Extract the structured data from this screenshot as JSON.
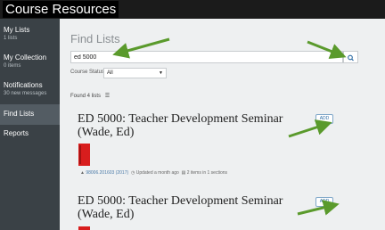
{
  "app": {
    "title": "Course Resources"
  },
  "sidebar": {
    "items": [
      {
        "label": "My Lists",
        "sub": "1 lists"
      },
      {
        "label": "My Collection",
        "sub": "0 items"
      },
      {
        "label": "Notifications",
        "sub": "30 new messages"
      },
      {
        "label": "Find Lists",
        "sub": ""
      },
      {
        "label": "Reports",
        "sub": ""
      }
    ]
  },
  "main": {
    "title": "Find Lists",
    "search": {
      "value": "ed 5000",
      "placeholder": ""
    },
    "status": {
      "label": "Course Status",
      "selected": "All"
    },
    "found_text": "Found 4 lists",
    "results": [
      {
        "title_line1": "ED 5000: Teacher Development Seminar",
        "title_line2": "(Wade, Ed)",
        "add_label": "ADD",
        "course_code": "98006.201603 (2017)",
        "updated": "Updated a month ago",
        "items": "2 items in 1 sections"
      },
      {
        "title_line1": "ED 5000: Teacher Development Seminar",
        "title_line2": "(Wade, Ed)",
        "add_label": "ADD"
      }
    ]
  },
  "colors": {
    "sidebar_bg": "#3a4146",
    "active_item": "#535c63",
    "arrow": "#5a9a2c",
    "book": "#d81d1d",
    "link": "#2b6aa3"
  },
  "icons": [
    "search-icon",
    "list-icon",
    "caret-down-icon",
    "graduation-cap-icon",
    "clock-icon",
    "document-icon"
  ]
}
